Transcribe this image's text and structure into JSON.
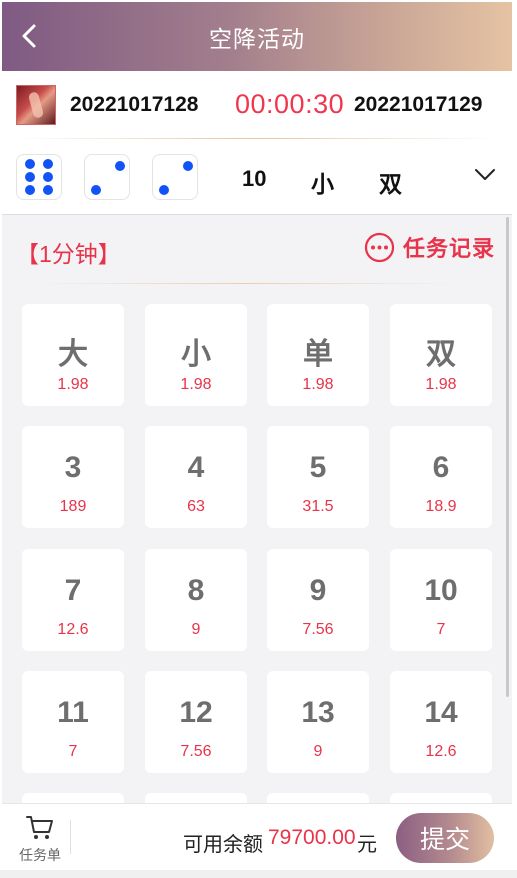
{
  "header": {
    "title": "空降活动",
    "back_icon": "chevron-left-icon"
  },
  "issue": {
    "previous_number": "20221017128",
    "countdown": "00:00:30",
    "current_number": "20221017129"
  },
  "last_result": {
    "dice": [
      6,
      2,
      2
    ],
    "sum": "10",
    "size": "小",
    "parity": "双",
    "expand_icon": "chevron-down-icon"
  },
  "panel": {
    "period": "【1分钟】",
    "records_label": "任务记录",
    "records_icon": "ellipsis-circle-icon"
  },
  "bets": [
    {
      "label": "大",
      "odds": "1.98"
    },
    {
      "label": "小",
      "odds": "1.98"
    },
    {
      "label": "单",
      "odds": "1.98"
    },
    {
      "label": "双",
      "odds": "1.98"
    },
    {
      "label": "3",
      "odds": "189"
    },
    {
      "label": "4",
      "odds": "63"
    },
    {
      "label": "5",
      "odds": "31.5"
    },
    {
      "label": "6",
      "odds": "18.9"
    },
    {
      "label": "7",
      "odds": "12.6"
    },
    {
      "label": "8",
      "odds": "9"
    },
    {
      "label": "9",
      "odds": "7.56"
    },
    {
      "label": "10",
      "odds": "7"
    },
    {
      "label": "11",
      "odds": "7"
    },
    {
      "label": "12",
      "odds": "7.56"
    },
    {
      "label": "13",
      "odds": "9"
    },
    {
      "label": "14",
      "odds": "12.6"
    }
  ],
  "footer": {
    "cart_label": "任务单",
    "cart_icon": "cart-icon",
    "balance_label": "可用余额",
    "balance_amount": "79700.00",
    "balance_unit": "元",
    "submit_label": "提交"
  },
  "colors": {
    "accent_red": "#e8334a",
    "die_pip_blue": "#1253f5",
    "header_gradient_start": "#7f5a83",
    "header_gradient_end": "#e5c3a3"
  }
}
